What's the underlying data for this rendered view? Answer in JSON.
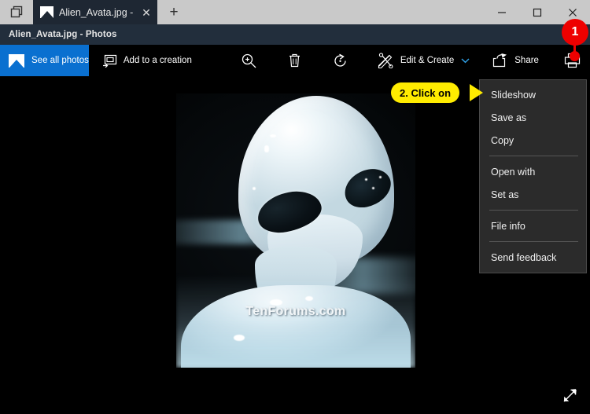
{
  "window": {
    "sets_icon": "sets-tabs-icon",
    "tab": {
      "title": "Alien_Avata.jpg - Photo",
      "close_label": "✕",
      "thumb_icon": "photo-thumbnail-icon"
    },
    "new_tab_label": "+",
    "controls": {
      "minimize": "minimize-icon",
      "maximize": "maximize-icon",
      "close": "close-icon"
    }
  },
  "header": {
    "title": "Alien_Avata.jpg - Photos"
  },
  "toolbar": {
    "see_all_photos": "See all photos",
    "add_to_creation": "Add to a creation",
    "zoom_icon": "zoom-in-icon",
    "delete_icon": "delete-icon",
    "rotate_icon": "rotate-icon",
    "edit_create": "Edit & Create",
    "edit_create_chevron": "chevron-down-icon",
    "share": "Share",
    "print_icon": "print-icon",
    "more_icon": "more-options-icon"
  },
  "photo": {
    "watermark": "TenForums.com",
    "alt": "alien-photo"
  },
  "viewer": {
    "fullscreen_icon": "fullscreen-icon"
  },
  "menu": {
    "items": [
      {
        "label": "Slideshow",
        "separator_after": false
      },
      {
        "label": "Save as",
        "separator_after": false
      },
      {
        "label": "Copy",
        "separator_after": true
      },
      {
        "label": "Open with",
        "separator_after": false
      },
      {
        "label": "Set as",
        "separator_after": true
      },
      {
        "label": "File info",
        "separator_after": true
      },
      {
        "label": "Send feedback",
        "separator_after": false
      }
    ]
  },
  "annotations": {
    "callout_text": "2. Click on",
    "marker_number": "1",
    "callout_color": "#ffec00",
    "marker_color": "#ee0000"
  }
}
